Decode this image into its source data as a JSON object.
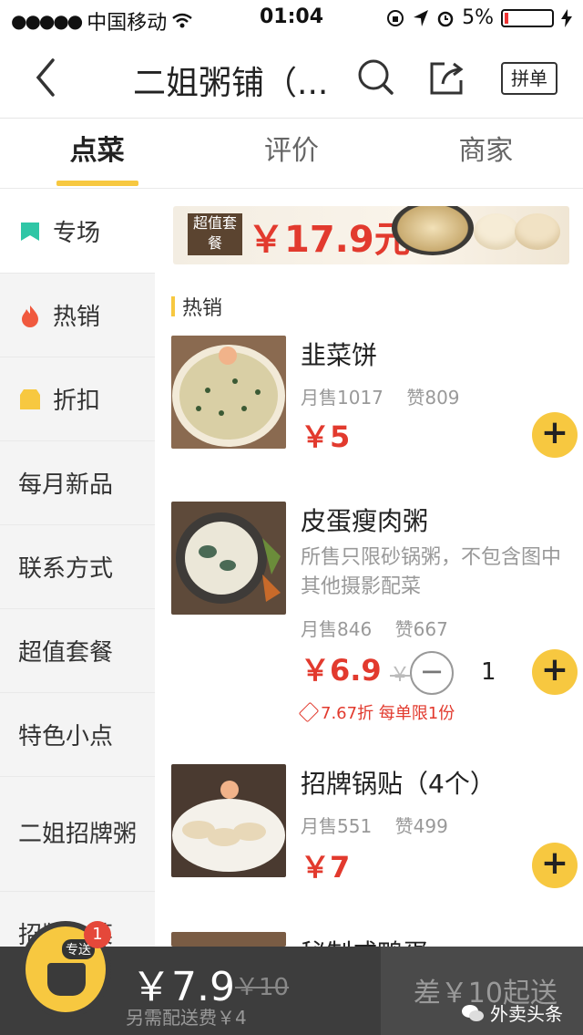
{
  "status_bar": {
    "carrier": "中国移动",
    "time": "01:04",
    "battery": "5%"
  },
  "nav": {
    "title": "二姐粥铺（...",
    "pindan_label": "拼单"
  },
  "tabs": [
    {
      "label": "点菜"
    },
    {
      "label": "评价"
    },
    {
      "label": "商家"
    }
  ],
  "sidebar": {
    "items": [
      {
        "label": "专场"
      },
      {
        "label": "热销"
      },
      {
        "label": "折扣"
      },
      {
        "label": "每月新品"
      },
      {
        "label": "联系方式"
      },
      {
        "label": "超值套餐"
      },
      {
        "label": "特色小点"
      },
      {
        "label": "二姐招牌粥"
      },
      {
        "label": "招牌小菜"
      }
    ]
  },
  "banner": {
    "tag": "超值套餐",
    "price": "￥17.9元"
  },
  "section": {
    "title": "热销"
  },
  "items": [
    {
      "name": "韭菜饼",
      "sales": "月售1017",
      "likes": "赞809",
      "price": "￥5"
    },
    {
      "name": "皮蛋瘦肉粥",
      "desc": "所售只限砂锅粥，不包含图中其他摄影配菜",
      "sales": "月售846",
      "likes": "赞667",
      "price": "￥6.9",
      "old_price": "￥",
      "qty": "1",
      "discount": "7.67折 每单限1份"
    },
    {
      "name": "招牌锅贴（4个）",
      "sales": "月售551",
      "likes": "赞499",
      "price": "￥7"
    },
    {
      "name": "秘制咸鸭蛋"
    }
  ],
  "bottom": {
    "cart_label": "专送",
    "cart_count": "1",
    "total": "￥7.9",
    "total_old": "￥10",
    "delivery_fee": "另需配送费￥4",
    "min_order": "差￥10起送",
    "watermark": "外卖头条"
  },
  "colors": {
    "accent": "#f7c840",
    "price_red": "#e23a2e"
  }
}
